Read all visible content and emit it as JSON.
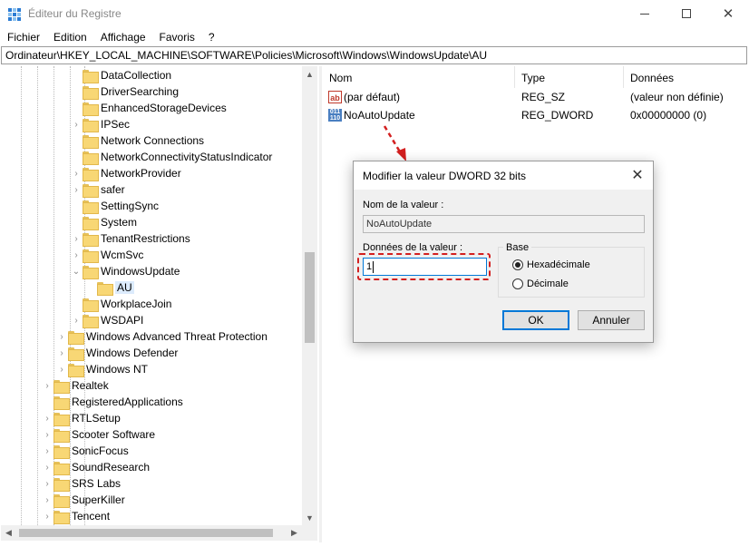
{
  "window": {
    "title": "Éditeur du Registre",
    "min_glyph": "—",
    "close_glyph": "✕"
  },
  "menu": [
    "Fichier",
    "Edition",
    "Affichage",
    "Favoris",
    "?"
  ],
  "address": "Ordinateur\\HKEY_LOCAL_MACHINE\\SOFTWARE\\Policies\\Microsoft\\Windows\\WindowsUpdate\\AU",
  "tree": {
    "items": [
      {
        "label": "DataCollection",
        "depth": 4,
        "expander": ""
      },
      {
        "label": "DriverSearching",
        "depth": 4,
        "expander": ""
      },
      {
        "label": "EnhancedStorageDevices",
        "depth": 4,
        "expander": ""
      },
      {
        "label": "IPSec",
        "depth": 4,
        "expander": ">"
      },
      {
        "label": "Network Connections",
        "depth": 4,
        "expander": ""
      },
      {
        "label": "NetworkConnectivityStatusIndicator",
        "depth": 4,
        "expander": ""
      },
      {
        "label": "NetworkProvider",
        "depth": 4,
        "expander": ">"
      },
      {
        "label": "safer",
        "depth": 4,
        "expander": ">"
      },
      {
        "label": "SettingSync",
        "depth": 4,
        "expander": ""
      },
      {
        "label": "System",
        "depth": 4,
        "expander": ""
      },
      {
        "label": "TenantRestrictions",
        "depth": 4,
        "expander": ">"
      },
      {
        "label": "WcmSvc",
        "depth": 4,
        "expander": ">"
      },
      {
        "label": "WindowsUpdate",
        "depth": 4,
        "expander": "v"
      },
      {
        "label": "AU",
        "depth": 5,
        "expander": "",
        "selected": true
      },
      {
        "label": "WorkplaceJoin",
        "depth": 4,
        "expander": ""
      },
      {
        "label": "WSDAPI",
        "depth": 4,
        "expander": ">"
      },
      {
        "label": "Windows Advanced Threat Protection",
        "depth": 3,
        "expander": ">"
      },
      {
        "label": "Windows Defender",
        "depth": 3,
        "expander": ">"
      },
      {
        "label": "Windows NT",
        "depth": 3,
        "expander": ">"
      },
      {
        "label": "Realtek",
        "depth": 2,
        "expander": ">"
      },
      {
        "label": "RegisteredApplications",
        "depth": 2,
        "expander": ""
      },
      {
        "label": "RTLSetup",
        "depth": 2,
        "expander": ">"
      },
      {
        "label": "Scooter Software",
        "depth": 2,
        "expander": ">"
      },
      {
        "label": "SonicFocus",
        "depth": 2,
        "expander": ">"
      },
      {
        "label": "SoundResearch",
        "depth": 2,
        "expander": ">"
      },
      {
        "label": "SRS Labs",
        "depth": 2,
        "expander": ">"
      },
      {
        "label": "SuperKiller",
        "depth": 2,
        "expander": ">"
      },
      {
        "label": "Tencent",
        "depth": 2,
        "expander": ">"
      }
    ]
  },
  "list": {
    "columns": [
      "Nom",
      "Type",
      "Données"
    ],
    "rows": [
      {
        "icon": "ab",
        "name": "(par défaut)",
        "type": "REG_SZ",
        "data": "(valeur non définie)"
      },
      {
        "icon": "011\n110",
        "name": "NoAutoUpdate",
        "type": "REG_DWORD",
        "data": "0x00000000 (0)"
      }
    ]
  },
  "dialog": {
    "title": "Modifier la valeur DWORD 32 bits",
    "close_glyph": "✕",
    "name_label": "Nom de la valeur :",
    "name_value": "NoAutoUpdate",
    "data_label": "Données de la valeur :",
    "data_value": "1",
    "base_label": "Base",
    "radio_hex": "Hexadécimale",
    "radio_dec": "Décimale",
    "selected_base": "hex",
    "ok_label": "OK",
    "cancel_label": "Annuler"
  },
  "colors": {
    "highlight": "#d31f1f",
    "accent": "#0078d7",
    "selection": "#dcebfc"
  }
}
